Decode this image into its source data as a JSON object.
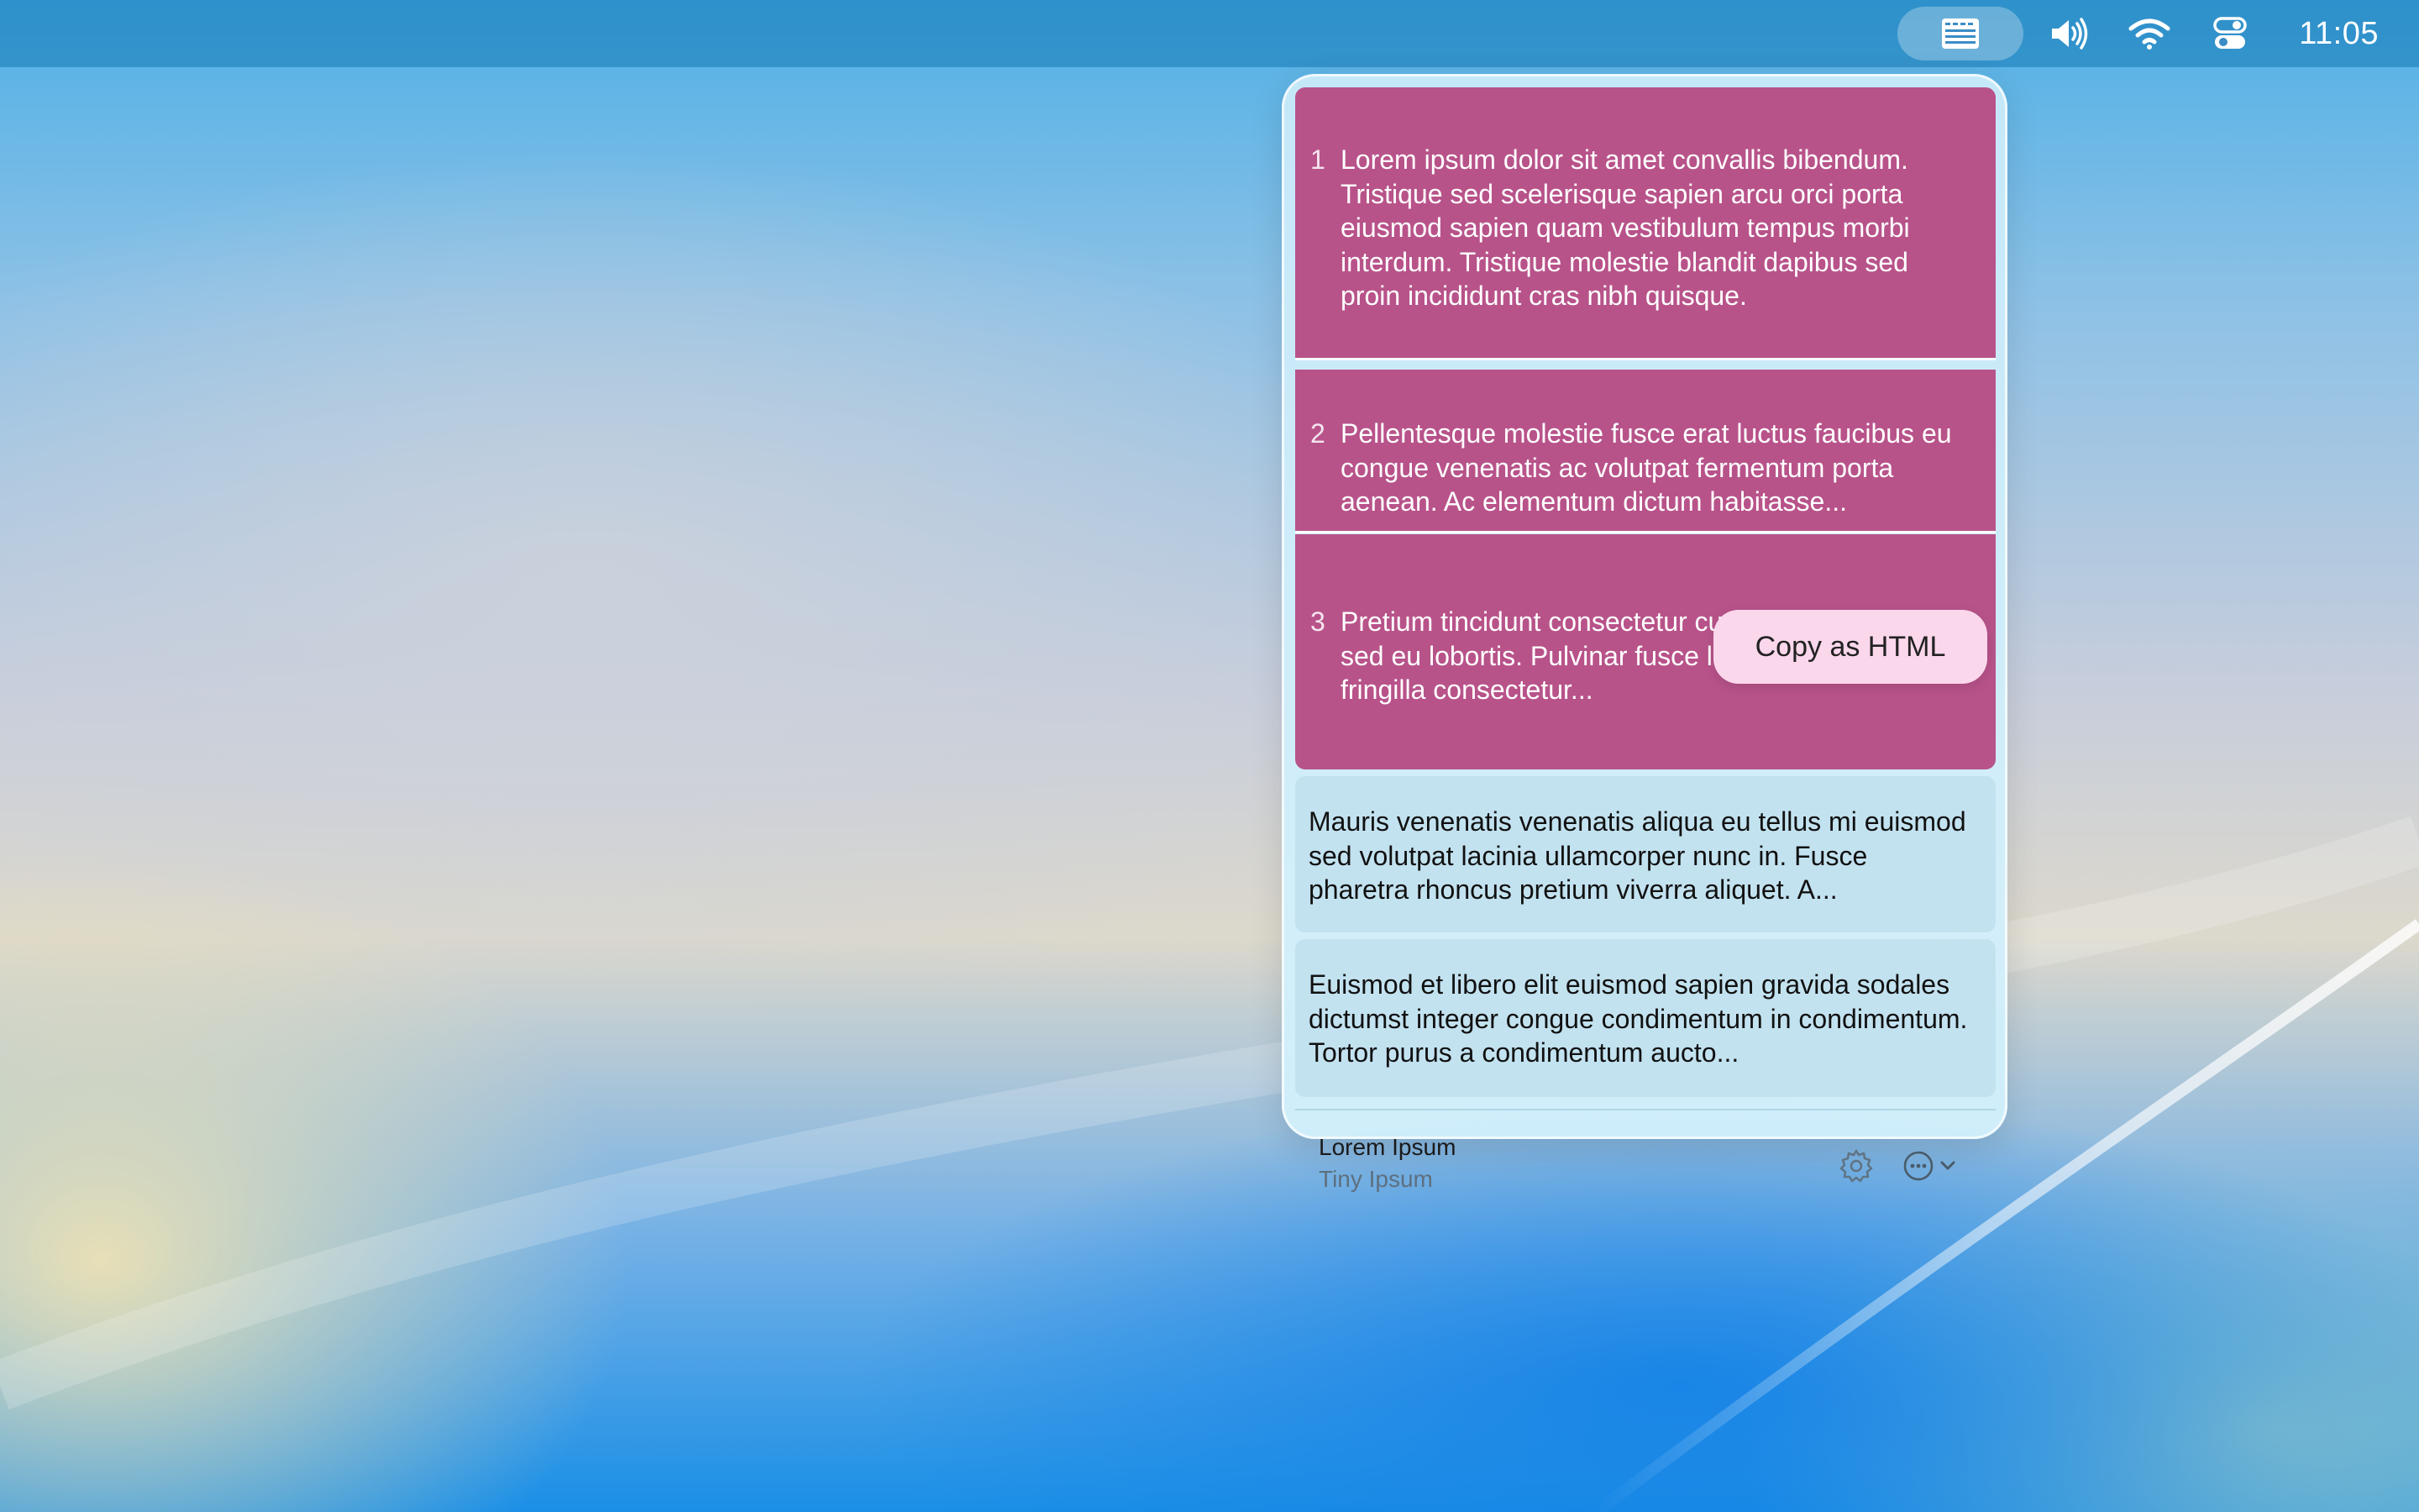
{
  "menubar": {
    "clock": "11:05",
    "icons": [
      "clipboard-manager-icon",
      "volume-icon",
      "wifi-icon",
      "control-center-icon"
    ]
  },
  "clipboard": {
    "selected_color": "#b8538a",
    "items": [
      {
        "number": "1",
        "text": "Lorem ipsum dolor sit amet convallis bibendum. Tristique sed scelerisque sapien arcu orci porta eiusmod sapien quam vestibulum tempus morbi interdum. Tristique molestie blandit dapibus sed proin incididunt cras nibh quisque."
      },
      {
        "number": "2",
        "text": "Pellentesque molestie fusce erat luctus faucibus eu congue venenatis ac volutpat fermentum porta aenean. Ac elementum dictum habitasse..."
      },
      {
        "number": "3",
        "text": "Pretium tincidunt consectetur cursus pretium nullam sed eu lobortis. Pulvinar fusce lorem volutpat non fringilla consectetur..."
      },
      {
        "number": "",
        "text": "Mauris venenatis venenatis aliqua eu tellus mi euismod sed volutpat lacinia ullamcorper nunc in. Fusce pharetra rhoncus pretium viverra aliquet. A..."
      },
      {
        "number": "",
        "text": "Euismod et libero elit euismod sapien gravida sodales dictumst integer congue condimentum in condimentum. Tortor purus a condimentum aucto..."
      }
    ],
    "copy_button": "Copy as HTML",
    "footer": {
      "title": "Lorem Ipsum",
      "subtitle": "Tiny Ipsum"
    }
  }
}
